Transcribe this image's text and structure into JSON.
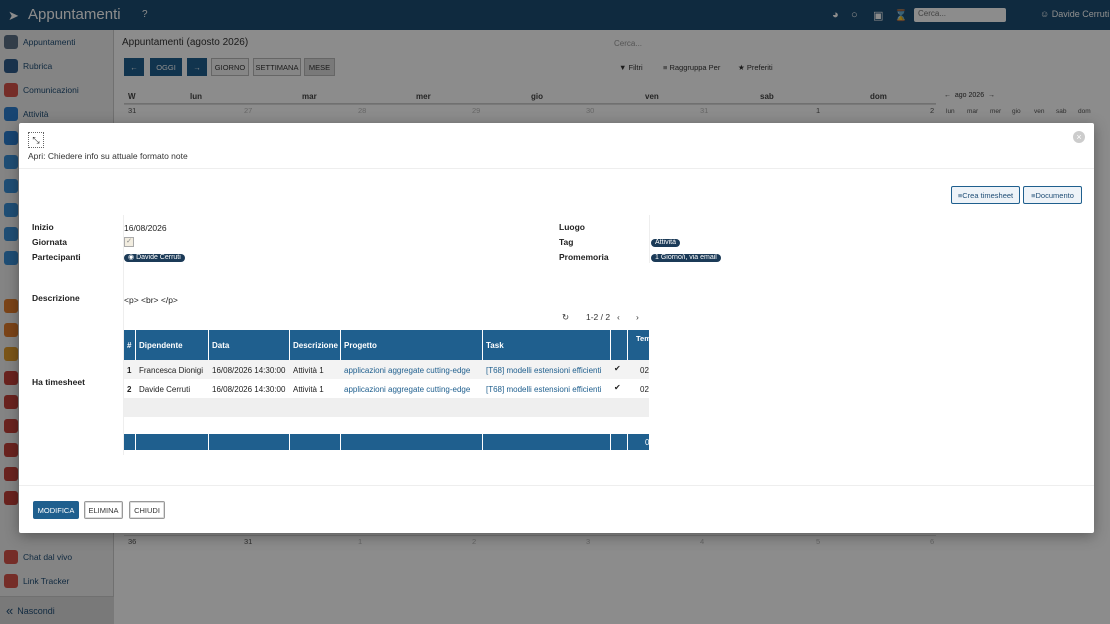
{
  "topbar": {
    "title": "Appuntamenti",
    "help": "?",
    "search_placeholder": "Cerca...",
    "user": "Davide Cerruti"
  },
  "sidebar": {
    "items": [
      {
        "label": "Appuntamenti",
        "color": "#5b6f86"
      },
      {
        "label": "Rubrica",
        "color": "#2f5c8a"
      },
      {
        "label": "Comunicazioni",
        "color": "#d6524a"
      },
      {
        "label": "Attività",
        "color": "#2c7fcf"
      },
      {
        "label": "",
        "color": "#2c7fcf"
      },
      {
        "label": "",
        "color": "#3a8fd6"
      },
      {
        "label": "",
        "color": "#3a8fd6"
      },
      {
        "label": "",
        "color": "#3a8fd6"
      },
      {
        "label": "",
        "color": "#3a8fd6"
      },
      {
        "label": "",
        "color": "#3a8fd6"
      },
      {
        "label": "",
        "color": "#e07c2c"
      },
      {
        "label": "",
        "color": "#e07c2c"
      },
      {
        "label": "",
        "color": "#e09b2c"
      },
      {
        "label": "",
        "color": "#c2403a"
      },
      {
        "label": "",
        "color": "#c2403a"
      },
      {
        "label": "",
        "color": "#c2403a"
      },
      {
        "label": "",
        "color": "#c2403a"
      },
      {
        "label": "",
        "color": "#c2403a"
      },
      {
        "label": "",
        "color": "#c2403a"
      },
      {
        "label": "Chat dal vivo",
        "color": "#d6524a"
      },
      {
        "label": "Link Tracker",
        "color": "#d6524a"
      }
    ],
    "hide_label": "Nascondi"
  },
  "calendar": {
    "title": "Appuntamenti (agosto 2026)",
    "search_placeholder": "Cerca...",
    "buttons": {
      "today": "OGGI",
      "day": "GIORNO",
      "week": "SETTIMANA",
      "month": "MESE"
    },
    "tools": {
      "filters": "Filtri",
      "group": "Raggruppa Per",
      "favorites": "Preferiti"
    },
    "week_col": "W",
    "days": [
      "lun",
      "mar",
      "mer",
      "gio",
      "ven",
      "sab",
      "dom"
    ],
    "row1": [
      "31",
      "27",
      "28",
      "29",
      "30",
      "31",
      "1",
      "2"
    ],
    "row_last": [
      "36",
      "31",
      "1",
      "2",
      "3",
      "4",
      "5",
      "6"
    ],
    "mini": {
      "month": "ago 2026",
      "days": [
        "lun",
        "mar",
        "mer",
        "gio",
        "ven",
        "sab",
        "dom"
      ]
    }
  },
  "modal": {
    "subtitle": "Apri: Chiedere info su attuale formato note",
    "actions": {
      "create_timesheet": "Crea timesheet",
      "document": "Documento"
    },
    "fields": {
      "start_label": "Inizio",
      "start_value": "16/08/2026",
      "allday_label": "Giornata",
      "participants_label": "Partecipanti",
      "participant": "Davide Cerruti",
      "location_label": "Luogo",
      "tag_label": "Tag",
      "tag": "Attività",
      "reminder_label": "Promemoria",
      "reminder": "1 Giorno/i, via email",
      "description_label": "Descrizione",
      "description_value": "<p> <br> </p>",
      "timesheet_label": "Ha timesheet"
    },
    "pager": "1-2 / 2",
    "table": {
      "headers": [
        "#",
        "Dipendente",
        "Data",
        "Descrizione",
        "Progetto",
        "Task",
        "",
        "Tem (O"
      ],
      "rows": [
        {
          "n": "1",
          "employee": "Francesca Dionigi",
          "date": "16/08/2026 14:30:00",
          "desc": "Attività 1",
          "project": "applicazioni aggregate cutting-edge",
          "task": "[T68] modelli estensioni efficienti",
          "time": "02"
        },
        {
          "n": "2",
          "employee": "Davide Cerruti",
          "date": "16/08/2026 14:30:00",
          "desc": "Attività 1",
          "project": "applicazioni aggregate cutting-edge",
          "task": "[T68] modelli estensioni efficienti",
          "time": "02"
        }
      ],
      "footer_total": "0"
    },
    "buttons": {
      "edit": "MODIFICA",
      "delete": "ELIMINA",
      "close": "CHIUDI"
    }
  }
}
